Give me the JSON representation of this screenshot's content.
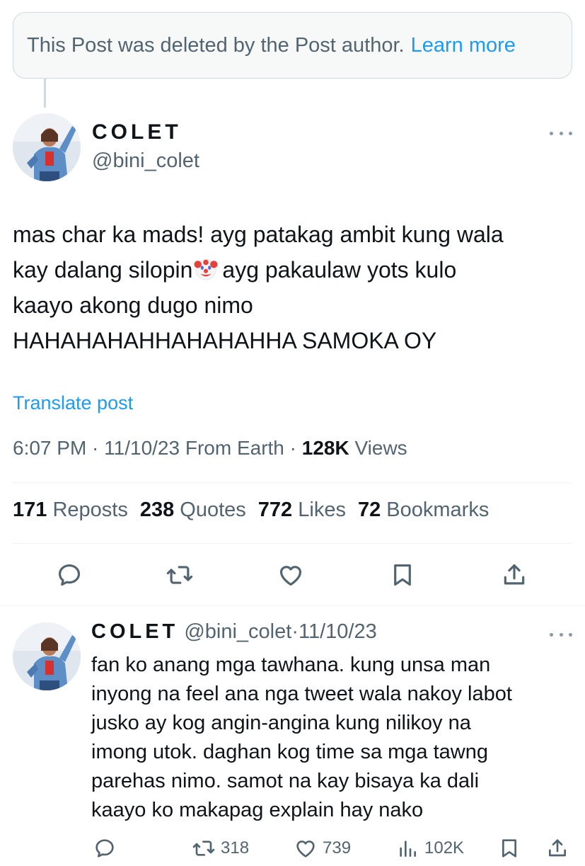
{
  "deleted_notice": {
    "message": "This Post was deleted by the Post author.",
    "link": "Learn more"
  },
  "post": {
    "author_name": "COLET",
    "author_handle": "@bini_colet",
    "text_lines": [
      "mas char ka mads! ayg patakag ambit kung wala",
      "kay dalang silopin",
      "ayg pakaulaw yots kulo",
      "kaayo akong dugo nimo",
      "HAHAHAHAHHAHAHAHHA SAMOKA OY"
    ],
    "emoji": "clown-face",
    "translate": "Translate post",
    "meta_prefix": "6:07 PM · 11/10/23 From Earth · ",
    "views_count": "128K",
    "views_label": " Views",
    "stats": {
      "reposts_count": "171",
      "reposts_label": " Reposts",
      "quotes_count": "238",
      "quotes_label": " Quotes",
      "likes_count": "772",
      "likes_label": " Likes",
      "bookmarks_count": "72",
      "bookmarks_label": " Bookmarks"
    },
    "actions": [
      "reply-icon",
      "repost-icon",
      "like-icon",
      "bookmark-icon",
      "share-icon"
    ]
  },
  "reply": {
    "author_name": "COLET",
    "author_handle": "@bini_colet",
    "separator": "·",
    "date": "11/10/23",
    "text_lines": [
      "fan ko anang mga tawhana. kung unsa man",
      "inyong na feel ana nga tweet wala nakoy labot",
      "jusko ay kog angin-angina kung nilikoy na",
      "imong utok. daghan kog time sa mga tawng",
      "parehas nimo. samot na kay bisaya ka dali",
      "kaayo ko makapag explain hay nako"
    ],
    "reposts": "318",
    "likes": "739",
    "views": "102K"
  },
  "colors": {
    "accent": "#1d9bf0",
    "text_primary": "#0f1419",
    "text_secondary": "#536471",
    "border": "#cfd9de"
  }
}
